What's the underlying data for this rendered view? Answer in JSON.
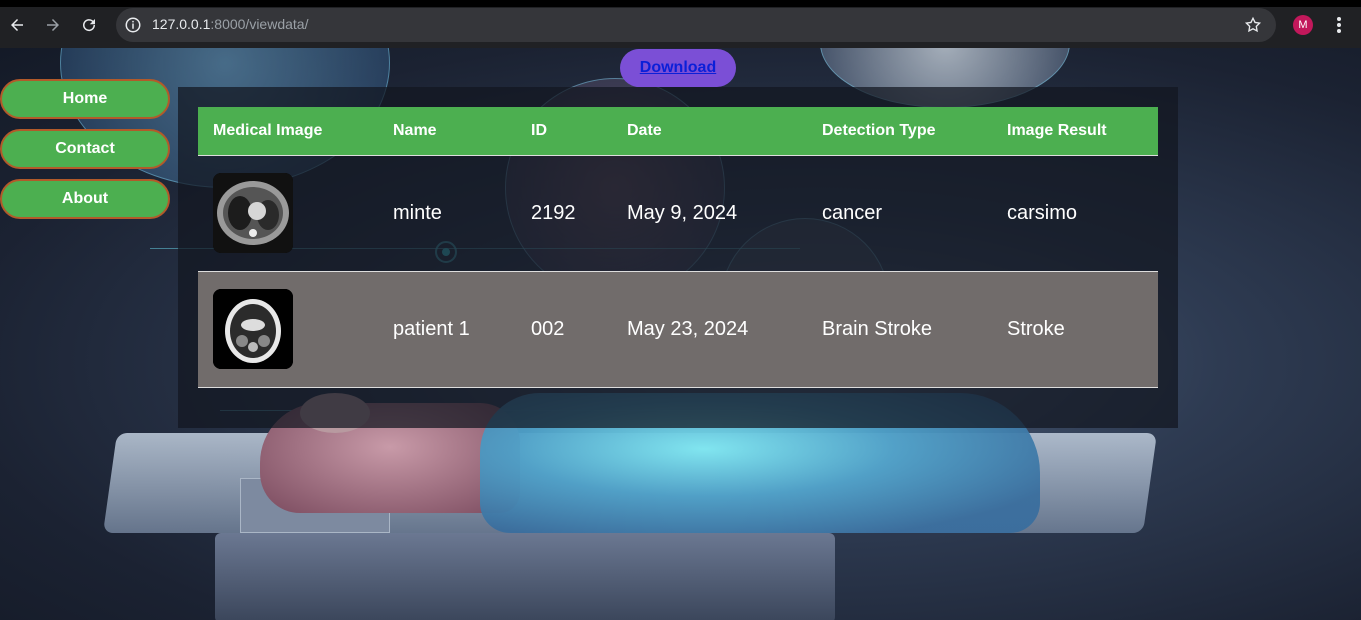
{
  "browser": {
    "url_host": "127.0.0.1",
    "url_path": ":8000/viewdata/",
    "profile_initial": "M",
    "icons": [
      "back-arrow-icon",
      "forward-arrow-icon",
      "reload-icon",
      "info-icon",
      "star-icon",
      "kebab-menu-icon"
    ]
  },
  "sidebar": {
    "items": [
      {
        "label": "Home"
      },
      {
        "label": "Contact"
      },
      {
        "label": "About"
      }
    ]
  },
  "download": {
    "label": "Download"
  },
  "table": {
    "headers": [
      "Medical Image",
      "Name",
      "ID",
      "Date",
      "Detection Type",
      "Image Result"
    ],
    "rows": [
      {
        "image": "chest-ct-scan",
        "name": "minte",
        "id": "2192",
        "date": "May 9, 2024",
        "detection_type": "cancer",
        "result": "carsimo"
      },
      {
        "image": "head-ct-scan",
        "name": "patient 1",
        "id": "002",
        "date": "May 23, 2024",
        "detection_type": "Brain Stroke",
        "result": "Stroke"
      }
    ]
  },
  "colors": {
    "accent_green": "#4caf50",
    "menu_border": "#b25a2a",
    "download_bg": "#7b4fd6",
    "download_link": "#0b1fd8",
    "row_highlight": "#716c6b"
  }
}
